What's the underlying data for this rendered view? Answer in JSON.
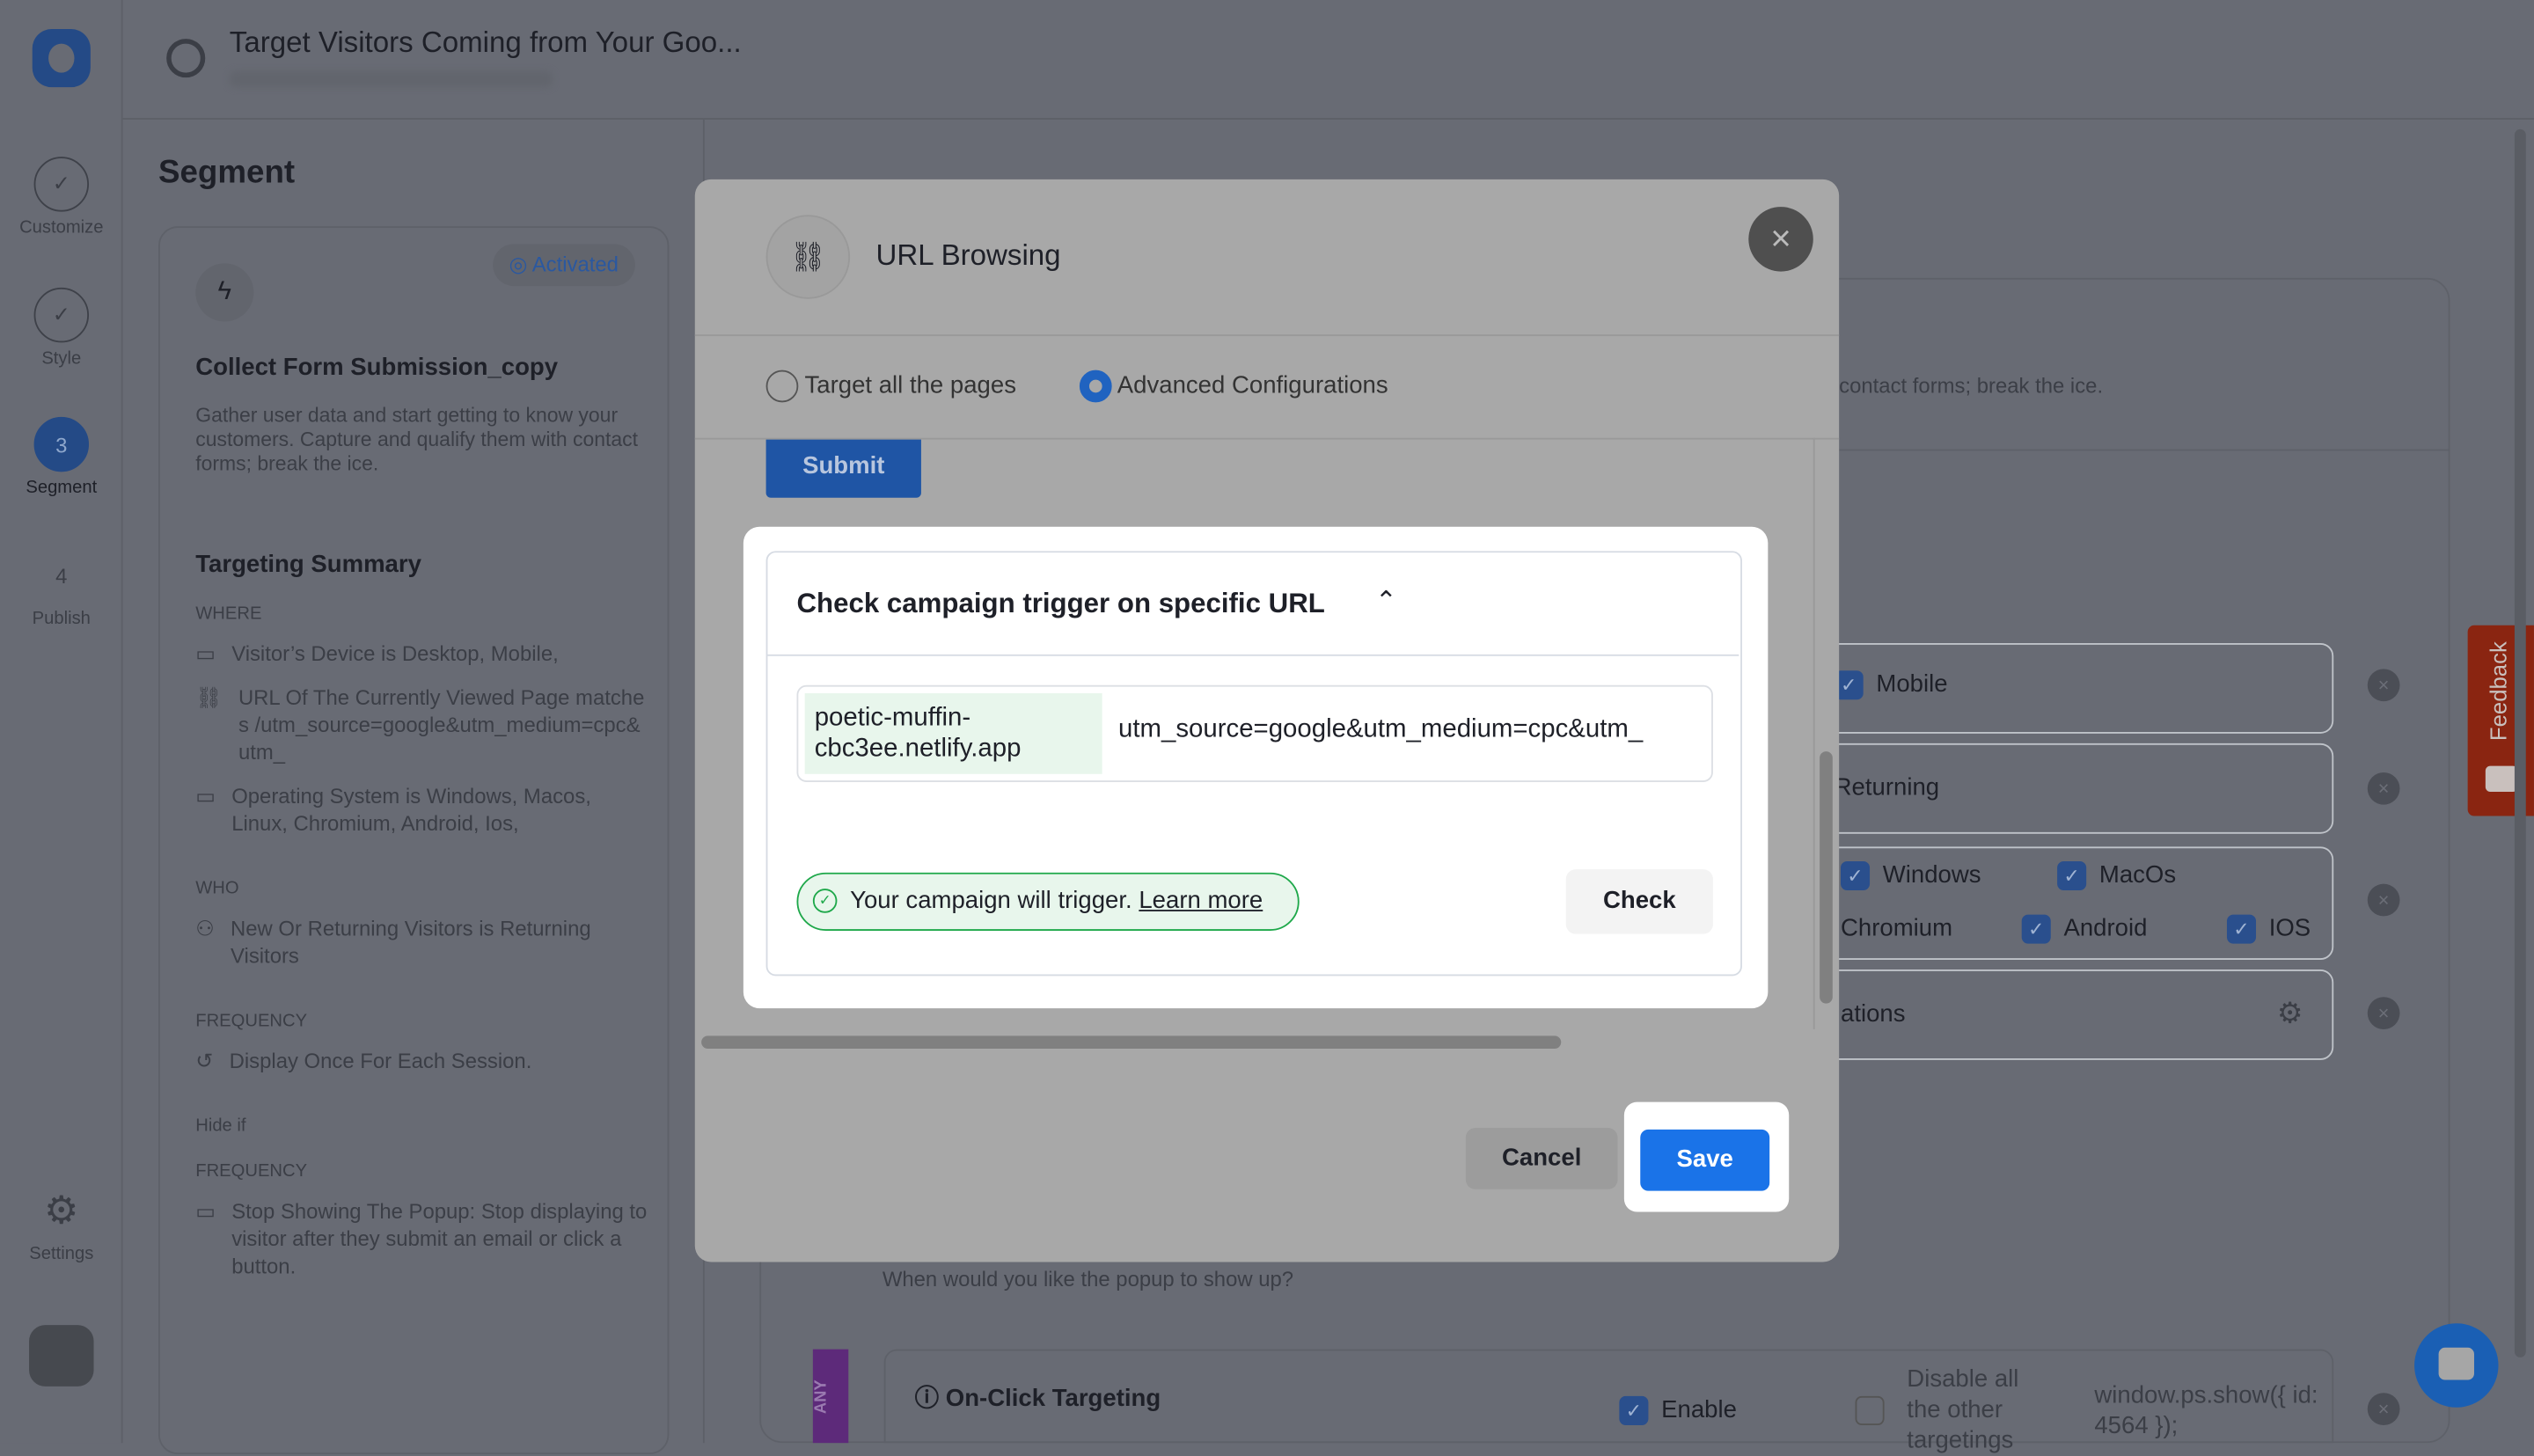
{
  "header": {
    "title": "Target Visitors Coming from Your Goo..."
  },
  "rail": {
    "steps": [
      {
        "label": "Customize",
        "mark": "✓"
      },
      {
        "label": "Style",
        "mark": "✓"
      },
      {
        "label": "Segment",
        "mark": "3"
      },
      {
        "label": "Publish",
        "mark": "4"
      }
    ],
    "settings": "Settings"
  },
  "panel": {
    "title": "Segment",
    "badge": "Activated",
    "card_title": "Collect Form Submission_copy",
    "card_desc": "Gather user data and start getting to know your customers. Capture and qualify them with contact forms; break the ice.",
    "summary_title": "Targeting Summary",
    "where_label": "WHERE",
    "where": [
      "Visitor’s Device is Desktop, Mobile,",
      "URL Of The Currently Viewed Page matches /utm_source=google&utm_medium=cpc&utm_",
      "Operating System is Windows, Macos, Linux, Chromium, Android, Ios,"
    ],
    "who_label": "WHO",
    "who": [
      "New Or Returning Visitors is Returning Visitors"
    ],
    "freq_label": "FREQUENCY",
    "freq": [
      "Display Once For Each Session."
    ],
    "hide_label": "Hide if",
    "freq2_label": "FREQUENCY",
    "freq2": [
      "Stop Showing The Popup: Stop displaying to visitor after they submit an email or click a button."
    ]
  },
  "background": {
    "desc_tail": "contact forms; break the ice.",
    "mobile": "Mobile",
    "returning": "Returning",
    "os": [
      "Windows",
      "MacOs",
      "Chromium",
      "Android",
      "IOS"
    ],
    "configurations_tail": "ations",
    "when": "When would you like the popup to show up?",
    "any": "ANY",
    "onclick": "On-Click Targeting",
    "enable": "Enable",
    "disable_all": "Disable all the other targetings",
    "code": "window.ps.show({ id: 4564 });",
    "feedback": "Feedback"
  },
  "modal": {
    "title": "URL Browsing",
    "options": [
      "Target all the pages",
      "Advanced Configurations"
    ],
    "selected": "Advanced Configurations",
    "submit": "Submit",
    "check_title": "Check campaign trigger on specific URL",
    "domain": "poetic-muffin-cbc3ee.netlify.app",
    "path_value": "utm_source=google&utm_medium=cpc&utm_",
    "status": "Your campaign will trigger.",
    "learn_more": "Learn more",
    "check": "Check",
    "cancel": "Cancel",
    "save": "Save"
  },
  "colors": {
    "primary": "#1a73e8",
    "success": "#1ea84a",
    "success_bg": "#e8f6ec",
    "domain_bg": "#e8f6ec",
    "feedback": "#8a2511",
    "overlay": "#686b74"
  }
}
